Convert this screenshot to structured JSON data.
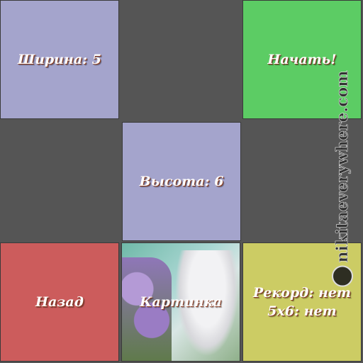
{
  "cells": {
    "width": "Ширина: 5",
    "start": "Начать!",
    "height": "Высота: 6",
    "back": "Назад",
    "picture": "Картинка",
    "record_line1": "Рекорд: нет",
    "record_line2": "5x6: нет"
  },
  "watermark": "nikitaeverywhere.com",
  "colors": {
    "background": "#555555",
    "lavender": "#a4a4cc",
    "green": "#5ccc64",
    "red": "#cc5c5c",
    "yellow": "#cccc64"
  }
}
